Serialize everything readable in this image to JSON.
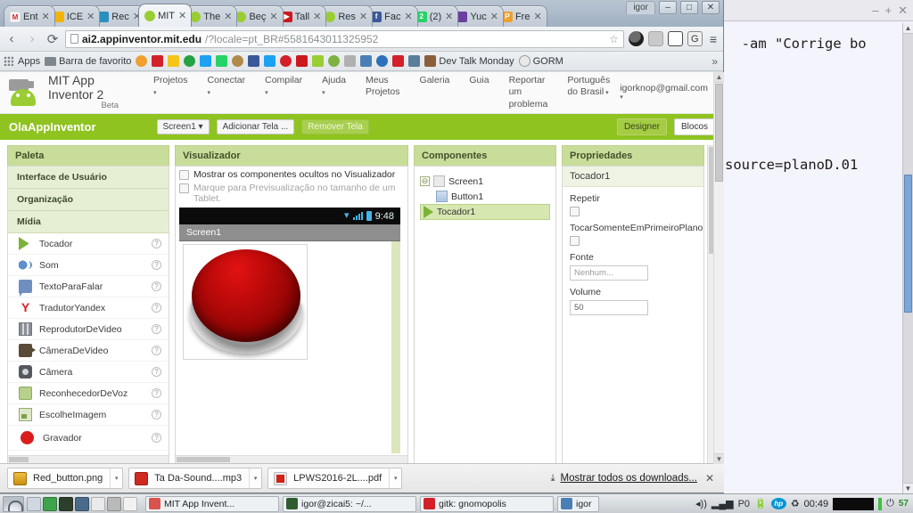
{
  "browser": {
    "window_label": "igor",
    "window_buttons": [
      "–",
      "□",
      "✕"
    ],
    "tabs": [
      {
        "title": "Ent",
        "favicon": "gmail-icon",
        "color": "#ffffff",
        "glyph": "M",
        "active": false
      },
      {
        "title": "ICE",
        "favicon": "folder-icon",
        "color": "#f5b301",
        "glyph": "",
        "active": false
      },
      {
        "title": "Rec",
        "favicon": "globe-icon",
        "color": "#2a8fbd",
        "glyph": "",
        "active": false
      },
      {
        "title": "MIT",
        "favicon": "appinventor-icon",
        "color": "#9acd32",
        "glyph": "",
        "active": true
      },
      {
        "title": "The",
        "favicon": "appinventor-icon",
        "color": "#9acd32",
        "glyph": "",
        "active": false
      },
      {
        "title": "Beç",
        "favicon": "appinventor-icon",
        "color": "#9acd32",
        "glyph": "",
        "active": false
      },
      {
        "title": "Tall",
        "favicon": "youtube-icon",
        "color": "#cc181e",
        "glyph": "▶",
        "active": false
      },
      {
        "title": "Res",
        "favicon": "appinventor-icon",
        "color": "#9acd32",
        "glyph": "",
        "active": false
      },
      {
        "title": "Fac",
        "favicon": "facebook-icon",
        "color": "#3b5998",
        "glyph": "f",
        "active": false
      },
      {
        "title": "(2)",
        "favicon": "whatsapp-icon",
        "color": "#25d366",
        "glyph": "2",
        "active": false
      },
      {
        "title": "Yuc",
        "favicon": "shield-icon",
        "color": "#6b3fa0",
        "glyph": "",
        "active": false
      },
      {
        "title": "Fre",
        "favicon": "page-icon",
        "color": "#f0a030",
        "glyph": "P",
        "active": false
      }
    ],
    "nav": {
      "back": "‹",
      "forward": "›",
      "reload": "⟳"
    },
    "url_strong": "ai2.appinventor.mit.edu",
    "url_dim": "/?locale=pt_BR#5581643011325952",
    "star": "☆",
    "menu": "≡",
    "omni_icons": [
      "avatar-icon",
      "extension-icon",
      "mail-icon",
      "grammarly-icon"
    ],
    "bookmarks": {
      "apps_label": "Apps",
      "folder_label": "Barra de favorito",
      "named": [
        {
          "label": "Dev Talk Monday",
          "color": "#8b5e3c"
        },
        {
          "label": "GORM",
          "color": "#8a8a8a"
        }
      ],
      "icon_colors": [
        "#f0a030",
        "#d3202a",
        "#f5c518",
        "#25a244",
        "#1da1f2",
        "#25d366",
        "#b08a4a",
        "#3b5998",
        "#1da1f2",
        "#d3202a",
        "#cc181e",
        "#9acd32",
        "#7cb342",
        "#b0b0b0",
        "#4a7fb5",
        "#2f6fbb",
        "#d3202a",
        "#5a7d9a"
      ],
      "overflow": "»"
    }
  },
  "appinventor": {
    "brand_line1": "MIT App Inventor 2",
    "brand_line2": "Beta",
    "menus": [
      "Projetos",
      "Conectar",
      "Compilar",
      "Ajuda",
      "Meus Projetos",
      "Galeria",
      "Guia",
      "Reportar um problema",
      "Português do Brasil"
    ],
    "menus_with_caret": [
      true,
      true,
      true,
      true,
      false,
      false,
      false,
      false,
      true
    ],
    "account": "igorknop@gmail.com",
    "project_title": "OlaAppInventor",
    "screen_selector": "Screen1",
    "add_screen": "Adicionar Tela ...",
    "remove_screen": "Remover Tela",
    "view_designer": "Designer",
    "view_blocks": "Blocos",
    "palette": {
      "header": "Paleta",
      "categories": [
        "Interface de Usuário",
        "Organização",
        "Mídia"
      ],
      "items": [
        {
          "label": "Tocador",
          "icon": "play-icon",
          "help": "?"
        },
        {
          "label": "Som",
          "icon": "sound-icon",
          "help": "?"
        },
        {
          "label": "TextoParaFalar",
          "icon": "text-to-speech-icon",
          "help": "?"
        },
        {
          "label": "TradutorYandex",
          "icon": "yandex-icon",
          "help": "?"
        },
        {
          "label": "ReprodutorDeVideo",
          "icon": "video-player-icon",
          "help": "?"
        },
        {
          "label": "CâmeraDeVideo",
          "icon": "camcorder-icon",
          "help": "?"
        },
        {
          "label": "Câmera",
          "icon": "camera-icon",
          "help": "?"
        },
        {
          "label": "ReconhecedorDeVoz",
          "icon": "voice-recognizer-icon",
          "help": "?"
        },
        {
          "label": "EscolheImagem",
          "icon": "image-picker-icon",
          "help": "?"
        },
        {
          "label": "Gravador",
          "icon": "sound-recorder-icon",
          "help": "?"
        }
      ]
    },
    "viewer": {
      "header": "Visualizador",
      "checkbox_hidden": "Mostrar os componentes ocultos no Visualizador",
      "checkbox_tablet": "Marque para Previsualização no tamanho de um Tablet.",
      "phone": {
        "status_time": "9:48",
        "screen_title": "Screen1",
        "button_image": "red-button-image"
      }
    },
    "components": {
      "header": "Componentes",
      "toggle": "⊖",
      "tree": [
        {
          "label": "Screen1",
          "icon": "screen-icon",
          "depth": 0,
          "selected": false
        },
        {
          "label": "Button1",
          "icon": "button-icon",
          "depth": 1,
          "selected": false
        },
        {
          "label": "Tocador1",
          "icon": "play-icon",
          "depth": 1,
          "selected": true
        }
      ]
    },
    "properties": {
      "header": "Propriedades",
      "subject": "Tocador1",
      "fields": [
        {
          "label": "Repetir",
          "type": "checkbox",
          "value": ""
        },
        {
          "label": "TocarSomenteEmPrimeiroPlano",
          "type": "checkbox",
          "value": ""
        },
        {
          "label": "Fonte",
          "type": "text",
          "value": "Nenhum...",
          "muted": true
        },
        {
          "label": "Volume",
          "type": "text",
          "value": "50",
          "muted": false
        }
      ]
    }
  },
  "downloads": {
    "items": [
      {
        "name": "Red_button.png",
        "kind": "png",
        "caret": "▾"
      },
      {
        "name": "Ta Da-Sound....mp3",
        "kind": "mp3",
        "caret": "▾"
      },
      {
        "name": "LPWS2016-2L....pdf",
        "kind": "pdf",
        "caret": "▾"
      }
    ],
    "show_all": "Mostrar todos os downloads...",
    "download_icon": "⤓",
    "close": "✕"
  },
  "terminal": {
    "window_buttons": [
      "–",
      "+",
      "✕"
    ],
    "line1": "  -am \"Corrige bo",
    "line2": "source=planoD.01"
  },
  "taskbar": {
    "launcher_colors": [
      "#cfd8e2",
      "#3fa34d",
      "#2c3e2c",
      "#4a6a8a",
      "#eaeaea",
      "#b9b9b9",
      "#f2f2f2"
    ],
    "tasks": [
      {
        "label": "MIT App Invent...",
        "icon": "chrome-icon",
        "color": "#d9534f"
      },
      {
        "label": "igor@zicai5: ~/...",
        "icon": "terminal-icon",
        "color": "#2f5d2f"
      },
      {
        "label": "gitk: gnomopolis",
        "icon": "gitk-icon",
        "color": "#d3202a"
      },
      {
        "label": "igor",
        "icon": "window-icon",
        "color": "#4a7fb5"
      }
    ],
    "tray": {
      "volume": "◂))",
      "network": "▂▄▆",
      "power_profile": "P0",
      "battery_icon": "battery-icon",
      "hp_icon": "hp",
      "updates_icon": "♻",
      "clock": "00:49",
      "battery_percent": "57"
    }
  }
}
